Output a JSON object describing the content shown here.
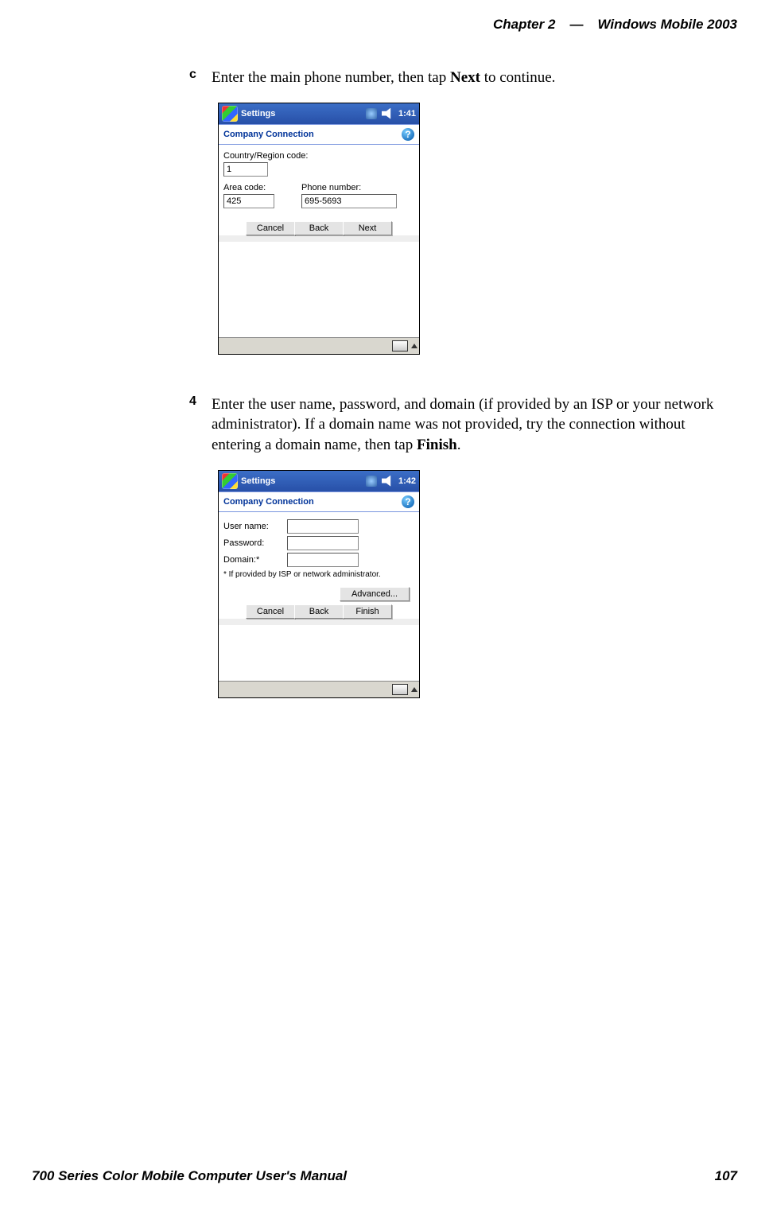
{
  "header": {
    "chapter": "Chapter",
    "num": "2",
    "dash": "—",
    "title": "Windows Mobile 2003"
  },
  "stepC": {
    "marker": "c",
    "pre": "Enter the main phone number, then tap ",
    "bold": "Next",
    "post": " to continue."
  },
  "step4": {
    "marker": "4",
    "pre": "Enter the user name, password, and domain (if provided by an ISP or your network administrator). If a domain name was not provided, try the connection without entering a domain name, then tap ",
    "bold": "Finish",
    "post": "."
  },
  "shot1": {
    "title": "Settings",
    "time": "1:41",
    "blue": "Company Connection",
    "country_lbl": "Country/Region code:",
    "country_val": "1",
    "area_lbl": "Area code:",
    "area_val": "425",
    "phone_lbl": "Phone number:",
    "phone_val": "695-5693",
    "cancel": "Cancel",
    "back": "Back",
    "next": "Next"
  },
  "shot2": {
    "title": "Settings",
    "time": "1:42",
    "blue": "Company Connection",
    "user_lbl": "User name:",
    "pass_lbl": "Password:",
    "domain_lbl": "Domain:*",
    "note": "* If provided by ISP or network administrator.",
    "advanced": "Advanced...",
    "cancel": "Cancel",
    "back": "Back",
    "finish": "Finish"
  },
  "footer": {
    "manual": "700 Series Color Mobile Computer User's Manual",
    "page": "107"
  }
}
